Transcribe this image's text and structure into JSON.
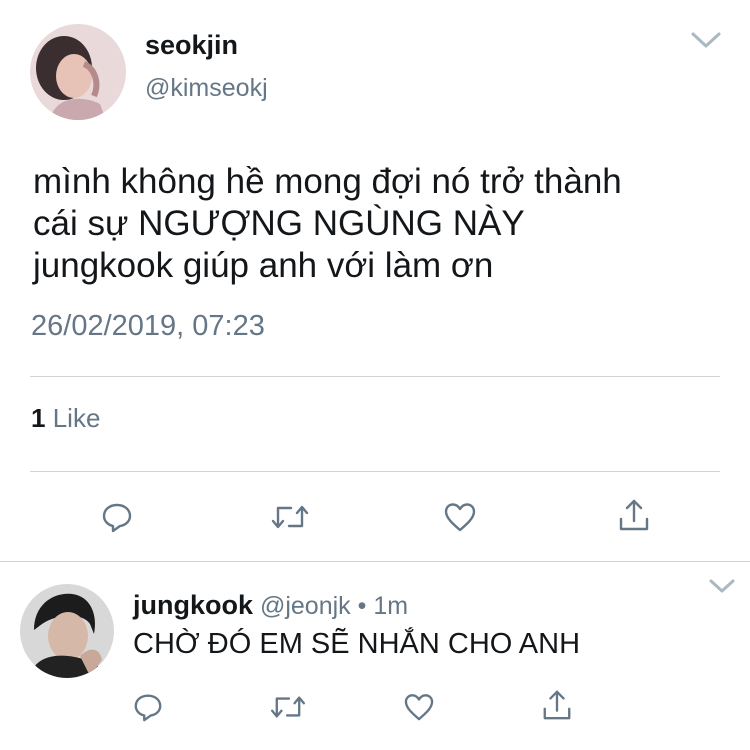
{
  "main_tweet": {
    "author_name": "seokjin",
    "author_handle": "@kimseokj",
    "text": "mình không hề mong đợi nó trở thành\ncái sự NGƯỢNG NGÙNG NÀY\njungkook giúp anh với làm ơn",
    "timestamp": "26/02/2019, 07:23",
    "like_count": "1",
    "like_label": "Like"
  },
  "reply": {
    "author_name": "jungkook",
    "author_handle": "@jeonjk",
    "separator": "•",
    "time_ago": "1m",
    "text": "CHỜ ĐÓ EM SẼ NHẮN CHO ANH"
  },
  "icons": {
    "menu": "chevron-down-icon",
    "reply": "reply-icon",
    "retweet": "retweet-icon",
    "like": "heart-icon",
    "share": "share-icon"
  },
  "colors": {
    "icon": "#657786",
    "text": "#14171a",
    "divider": "#d0d4d8"
  }
}
